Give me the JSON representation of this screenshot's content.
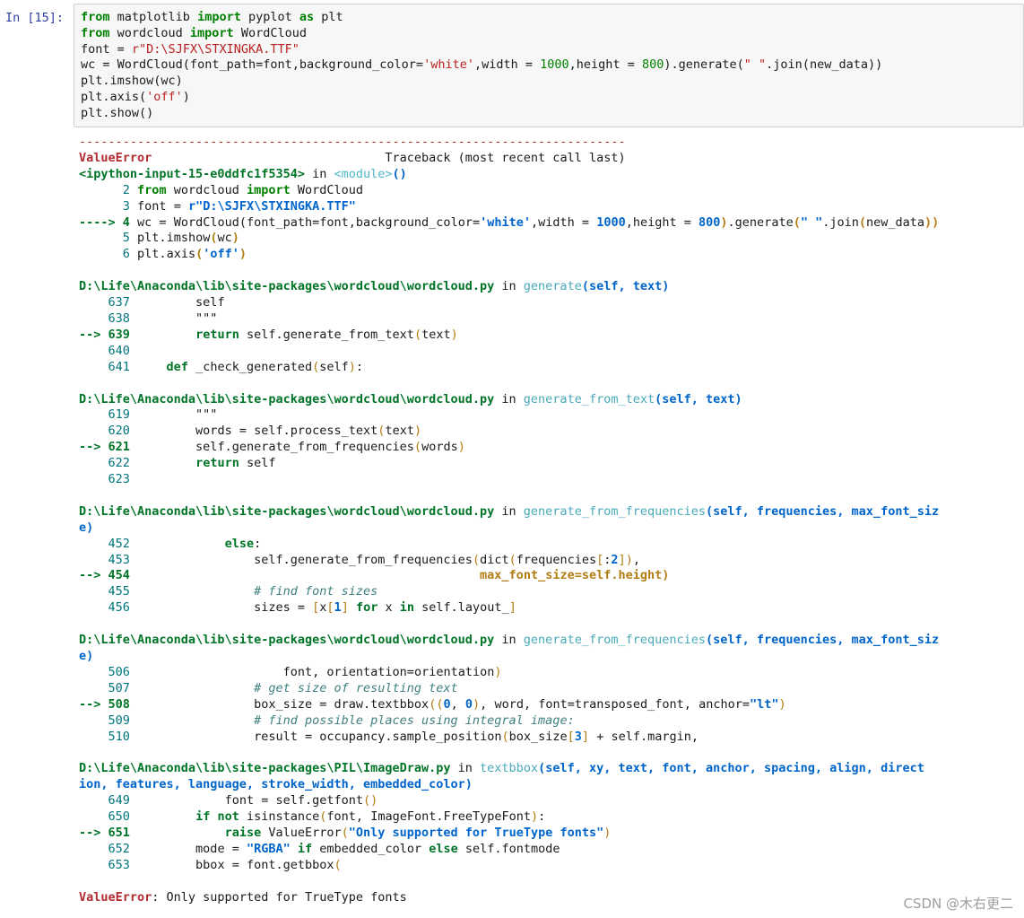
{
  "prompt": "In  [15]:",
  "input_lines": [
    "from matplotlib import pyplot as plt",
    "from wordcloud import WordCloud",
    "font = r\"D:\\SJFX\\STXINGKA.TTF\"",
    "wc = WordCloud(font_path=font,background_color='white',width = 1000,height = 800).generate(\" \".join(new_data))",
    "plt.imshow(wc)",
    "plt.axis('off')",
    "plt.show()"
  ],
  "traceback": {
    "separator": "---------------------------------------------------------------------------",
    "error_name": "ValueError",
    "header_right": "Traceback (most recent call last)",
    "frame0_source": "<ipython-input-15-e0ddfc1f5354>",
    "frame0_in": " in ",
    "frame0_func": "<module>",
    "frame0_func_tail": "()",
    "file_wordcloud": "D:\\Life\\Anaconda\\lib\\site-packages\\wordcloud\\wordcloud.py",
    "file_pil": "D:\\Life\\Anaconda\\lib\\site-packages\\PIL\\ImageDraw.py",
    "func_generate": "generate",
    "func_generate_from_text": "generate_from_text",
    "func_generate_from_frequencies": "generate_from_frequencies",
    "func_textbbox": "textbbox",
    "sig_generate": "(self, text)",
    "sig_generate_from_text": "(self, text)",
    "sig_gff_a": "(self, frequencies, max_font_siz",
    "sig_gff_b": "e)",
    "sig_textbbox_a": "(self, xy, text, font, anchor, spacing, align, direct",
    "sig_textbbox_b": "ion, features, language, stroke_width, embedded_color)",
    "final_error_name": "ValueError",
    "final_error_msg": ": Only supported for TrueType fonts"
  },
  "watermark": "CSDN @木右更二"
}
